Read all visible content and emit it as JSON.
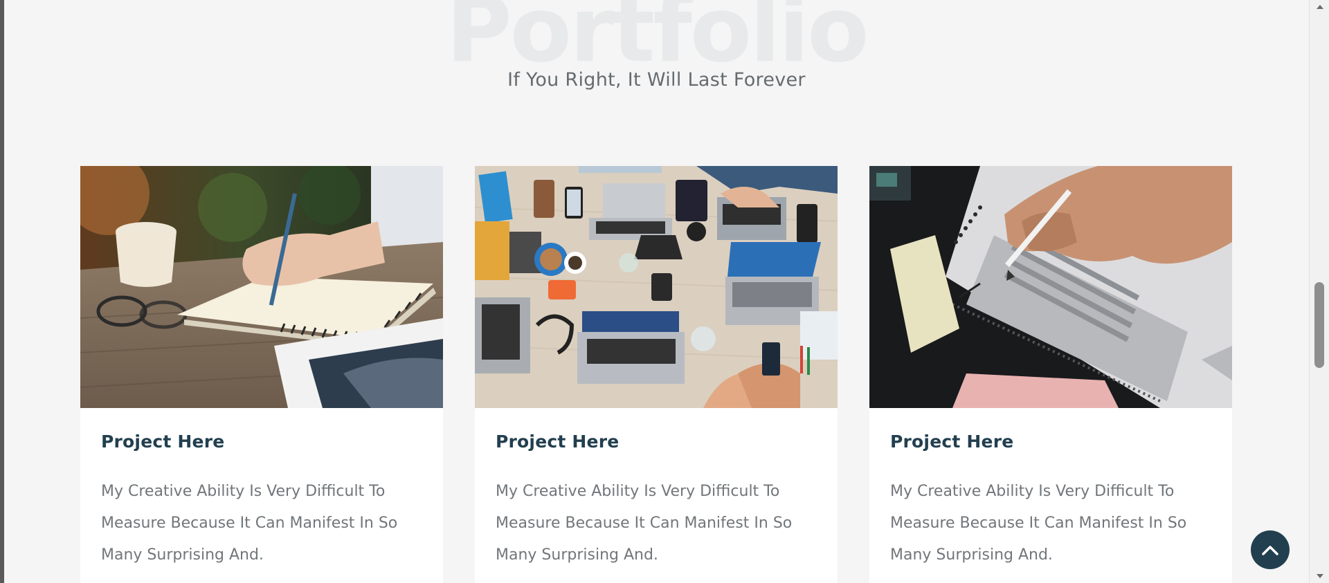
{
  "portfolio": {
    "background_title": "Portfolio",
    "subtitle": "If You Right, It Will Last Forever"
  },
  "projects": [
    {
      "title": "Project Here",
      "description": "My Creative Ability Is Very Difficult To Measure Because It Can Manifest In So Many Surprising And.",
      "image": "person-writing-in-notebook-photo"
    },
    {
      "title": "Project Here",
      "description": "My Creative Ability Is Very Difficult To Measure Because It Can Manifest In So Many Surprising And.",
      "image": "team-laptops-desk-photo"
    },
    {
      "title": "Project Here",
      "description": "My Creative Ability Is Very Difficult To Measure Because It Can Manifest In So Many Surprising And.",
      "image": "hand-filling-answer-sheet-photo"
    }
  ],
  "back_to_top": {
    "icon": "chevron-up-icon"
  },
  "colors": {
    "accent": "#223f4f",
    "page_background": "#f5f5f5",
    "card_background": "#ffffff",
    "text_muted": "#71767a"
  }
}
